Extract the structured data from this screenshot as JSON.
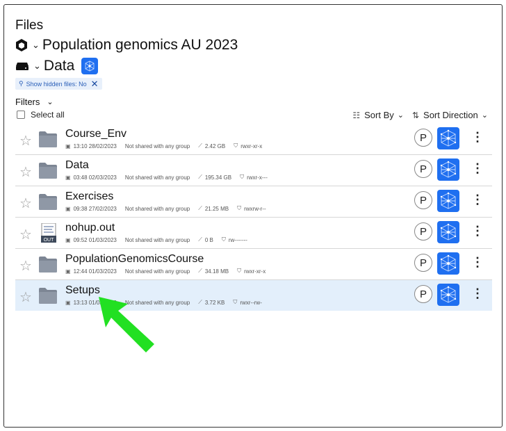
{
  "header": {
    "title": "Files",
    "project": "Population genomics AU 2023",
    "drive": "Data"
  },
  "chip": {
    "label": "Show hidden files: No"
  },
  "filters": {
    "label": "Filters"
  },
  "select_all": {
    "label": "Select all"
  },
  "sort": {
    "by_label": "Sort By",
    "direction_label": "Sort Direction"
  },
  "files": [
    {
      "name": "Course_Env",
      "modified": "13:10 28/02/2023",
      "sharing": "Not shared with any group",
      "size": "2.42 GB",
      "perms": "rwxr-xr-x",
      "type": "folder",
      "avatar": "P",
      "selected": false
    },
    {
      "name": "Data",
      "modified": "03:48 02/03/2023",
      "sharing": "Not shared with any group",
      "size": "195.34 GB",
      "perms": "rwxr-x---",
      "type": "folder",
      "avatar": "P",
      "selected": false
    },
    {
      "name": "Exercises",
      "modified": "09:38 27/02/2023",
      "sharing": "Not shared with any group",
      "size": "21.25 MB",
      "perms": "rwxrw-r--",
      "type": "folder",
      "avatar": "P",
      "selected": false
    },
    {
      "name": "nohup.out",
      "modified": "09:52 01/03/2023",
      "sharing": "Not shared with any group",
      "size": "0 B",
      "perms": "rw-------",
      "type": "file",
      "file_badge": "OUT",
      "avatar": "P",
      "selected": false
    },
    {
      "name": "PopulationGenomicsCourse",
      "modified": "12:44 01/03/2023",
      "sharing": "Not shared with any group",
      "size": "34.18 MB",
      "perms": "rwxr-xr-x",
      "type": "folder",
      "avatar": "P",
      "selected": false
    },
    {
      "name": "Setups",
      "modified": "13:13 01/03/2023",
      "sharing": "Not shared with any group",
      "size": "3.72 KB",
      "perms": "rwxr--rw-",
      "type": "folder",
      "avatar": "P",
      "selected": true
    }
  ],
  "colors": {
    "accent": "#1f6ff0",
    "selected_row": "#e3effb",
    "annotation_arrow": "#22e022"
  }
}
